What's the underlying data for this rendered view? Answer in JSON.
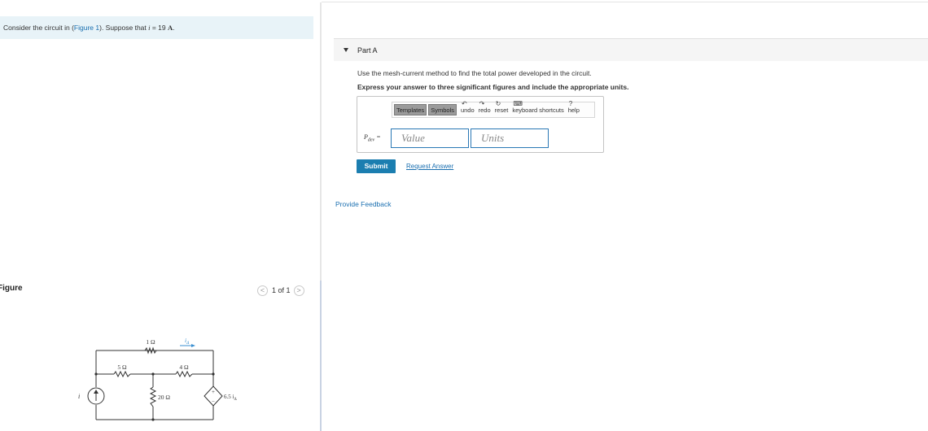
{
  "problem": {
    "prefix": "Consider the circuit in (",
    "figure_link": "Figure 1",
    "middle": "). Suppose that ",
    "var": "i",
    "equals": " = 19 ",
    "unit": "A",
    "suffix": "."
  },
  "figure": {
    "label": "Figure",
    "pager": {
      "prev": "<",
      "count": "1 of 1",
      "next": ">"
    },
    "circuit": {
      "r1": "1 Ω",
      "r2": "5 Ω",
      "r3": "4 Ω",
      "r4": "20 Ω",
      "current_label": "i",
      "current_sub": "Δ",
      "source_label": "i",
      "dep_source": "6.5 i",
      "dep_sub": "Δ"
    }
  },
  "part": {
    "title": "Part A",
    "question": "Use the mesh-current method to find the total power developed in the circuit.",
    "instruction": "Express your answer to three significant figures and include the appropriate units.",
    "toolbar": {
      "templates": "Templates",
      "symbols": "Symbols",
      "undo": "undo",
      "redo": "redo",
      "reset": "reset",
      "keyboard": "keyboard shortcuts",
      "help": "help"
    },
    "answer_label": "P",
    "answer_sub": "dev",
    "answer_eq": " =",
    "value_placeholder": "Value",
    "units_placeholder": "Units",
    "submit": "Submit",
    "request_answer": "Request Answer"
  },
  "feedback": "Provide Feedback",
  "colors": {
    "link": "#1a6fb0",
    "submit_bg": "#1b7eb0",
    "problem_bg": "#e8f3f8",
    "field_border": "#2a78b5"
  }
}
